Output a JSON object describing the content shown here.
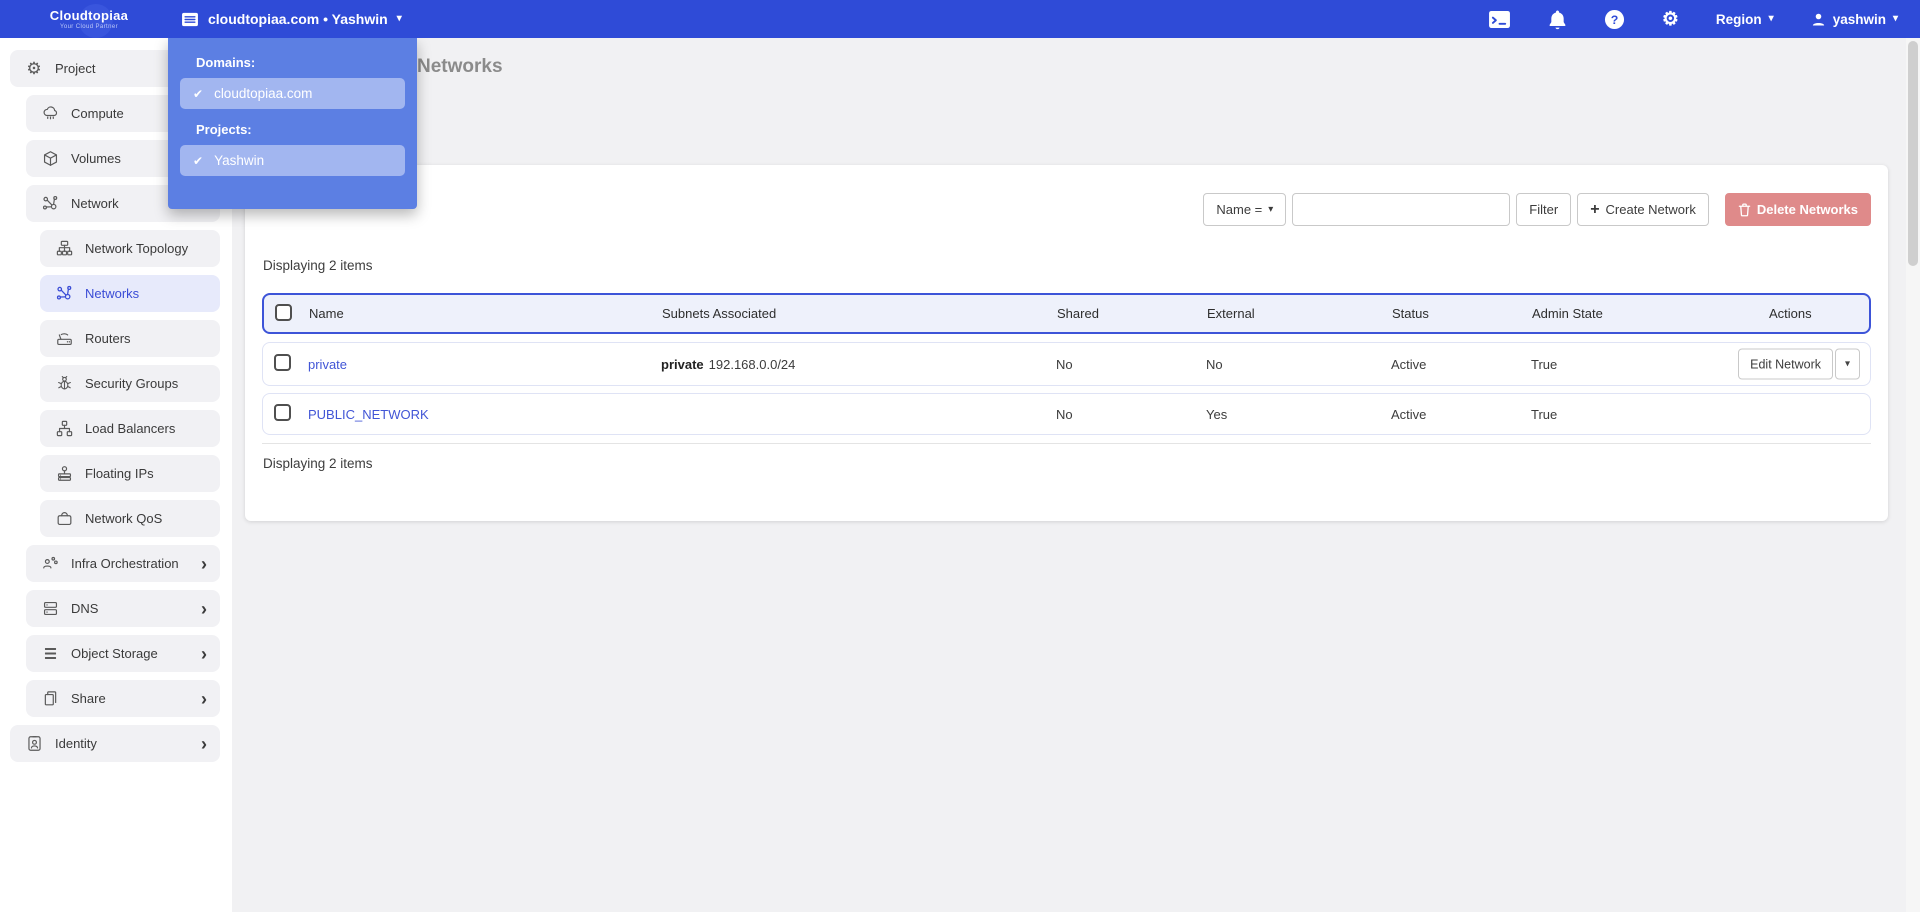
{
  "navbar": {
    "brand_name": "Cloudtopiaa",
    "brand_tagline": "Your Cloud Partner",
    "context_label": "cloudtopiaa.com • Yashwin",
    "region_label": "Region",
    "user_label": "yashwin"
  },
  "context_menu": {
    "domains_label": "Domains:",
    "domain_item": "cloudtopiaa.com",
    "projects_label": "Projects:",
    "project_item": "Yashwin"
  },
  "sidebar": {
    "items": [
      {
        "label": "Project"
      },
      {
        "label": "Compute"
      },
      {
        "label": "Volumes"
      },
      {
        "label": "Network"
      },
      {
        "label": "Network Topology"
      },
      {
        "label": "Networks",
        "active": true
      },
      {
        "label": "Routers"
      },
      {
        "label": "Security Groups"
      },
      {
        "label": "Load Balancers"
      },
      {
        "label": "Floating IPs"
      },
      {
        "label": "Network QoS"
      },
      {
        "label": "Infra Orchestration",
        "chevron": true
      },
      {
        "label": "DNS",
        "chevron": true
      },
      {
        "label": "Object Storage",
        "chevron": true
      },
      {
        "label": "Share",
        "chevron": true
      },
      {
        "label": "Identity",
        "chevron": true
      }
    ]
  },
  "page": {
    "title": "Networks"
  },
  "toolbar": {
    "name_filter_label": "Name =",
    "search_value": "",
    "filter_label": "Filter",
    "create_label": "Create Network",
    "delete_label": "Delete Networks"
  },
  "table": {
    "displaying_top": "Displaying 2 items",
    "displaying_bottom": "Displaying 2 items",
    "columns": {
      "name": "Name",
      "subnets": "Subnets Associated",
      "shared": "Shared",
      "external": "External",
      "status": "Status",
      "admin_state": "Admin State",
      "actions": "Actions"
    },
    "rows": [
      {
        "name": "private",
        "subnet_name": "private",
        "subnet_cidr": "192.168.0.0/24",
        "shared": "No",
        "external": "No",
        "status": "Active",
        "admin_state": "True",
        "action_label": "Edit Network"
      },
      {
        "name": "PUBLIC_NETWORK",
        "subnet_name": "",
        "subnet_cidr": "",
        "shared": "No",
        "external": "Yes",
        "status": "Active",
        "admin_state": "True"
      }
    ]
  },
  "icons": {
    "caret_down": "▾",
    "check": "✔",
    "chevron_right": "›",
    "plus": "+",
    "gear_glyph": "⚙",
    "question": "?"
  },
  "colors": {
    "navbar": "#2f4bd7",
    "dropdown_panel": "#5c7fe3",
    "dropdown_item": "#a2b6f0",
    "sidebar_active_bg": "#e7eafb",
    "table_header_border": "#3d54d8",
    "table_header_bg": "#eef1fb",
    "link": "#4155d6",
    "delete_button": "#df8a8a"
  }
}
